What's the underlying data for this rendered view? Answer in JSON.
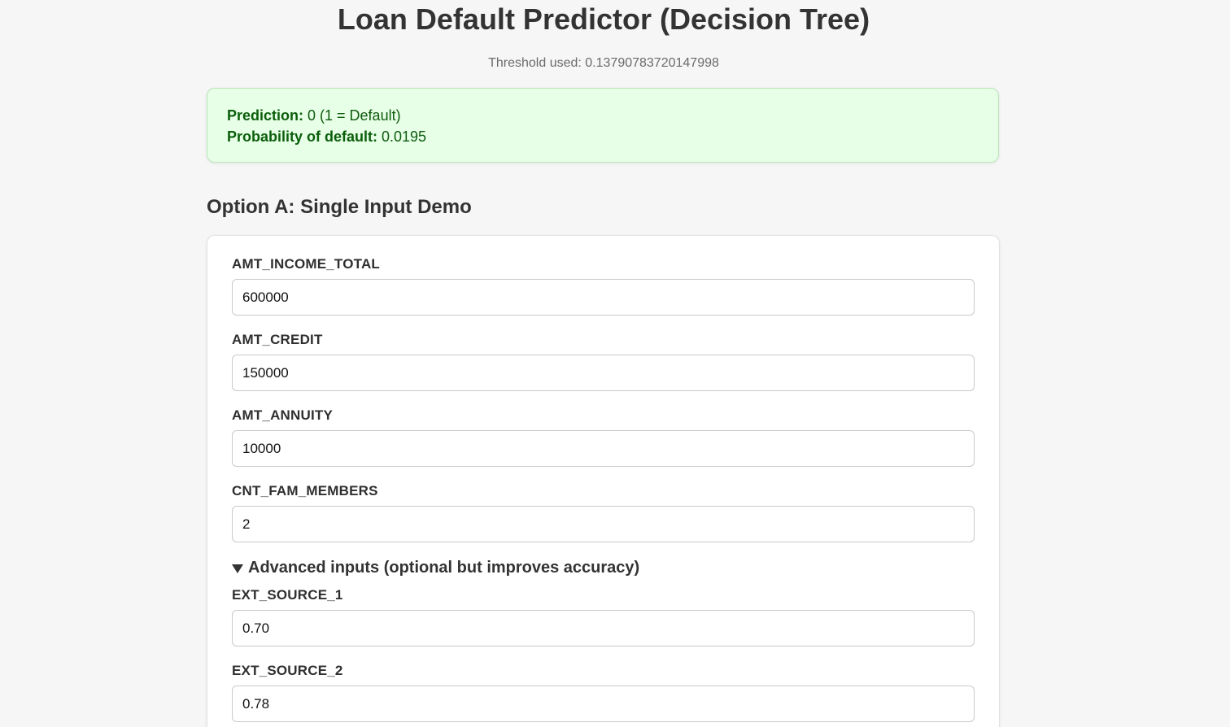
{
  "header": {
    "title": "Loan Default Predictor (Decision Tree)",
    "threshold_text": "Threshold used: 0.13790783720147998"
  },
  "result": {
    "prediction_label": "Prediction:",
    "prediction_value": " 0 (1 = Default)",
    "probability_label": "Probability of default:",
    "probability_value": " 0.0195"
  },
  "section": {
    "title": "Option A: Single Input Demo"
  },
  "form": {
    "fields": [
      {
        "label": "AMT_INCOME_TOTAL",
        "value": "600000"
      },
      {
        "label": "AMT_CREDIT",
        "value": "150000"
      },
      {
        "label": "AMT_ANNUITY",
        "value": "10000"
      },
      {
        "label": "CNT_FAM_MEMBERS",
        "value": "2"
      }
    ],
    "advanced": {
      "summary": "Advanced inputs (optional but improves accuracy)",
      "icon": "triangle-down-icon",
      "fields": [
        {
          "label": "EXT_SOURCE_1",
          "value": "0.70"
        },
        {
          "label": "EXT_SOURCE_2",
          "value": "0.78"
        }
      ]
    }
  },
  "colors": {
    "background": "#f6f6f6",
    "result_bg": "#e6ffe6",
    "result_text": "#0f5a0f"
  }
}
